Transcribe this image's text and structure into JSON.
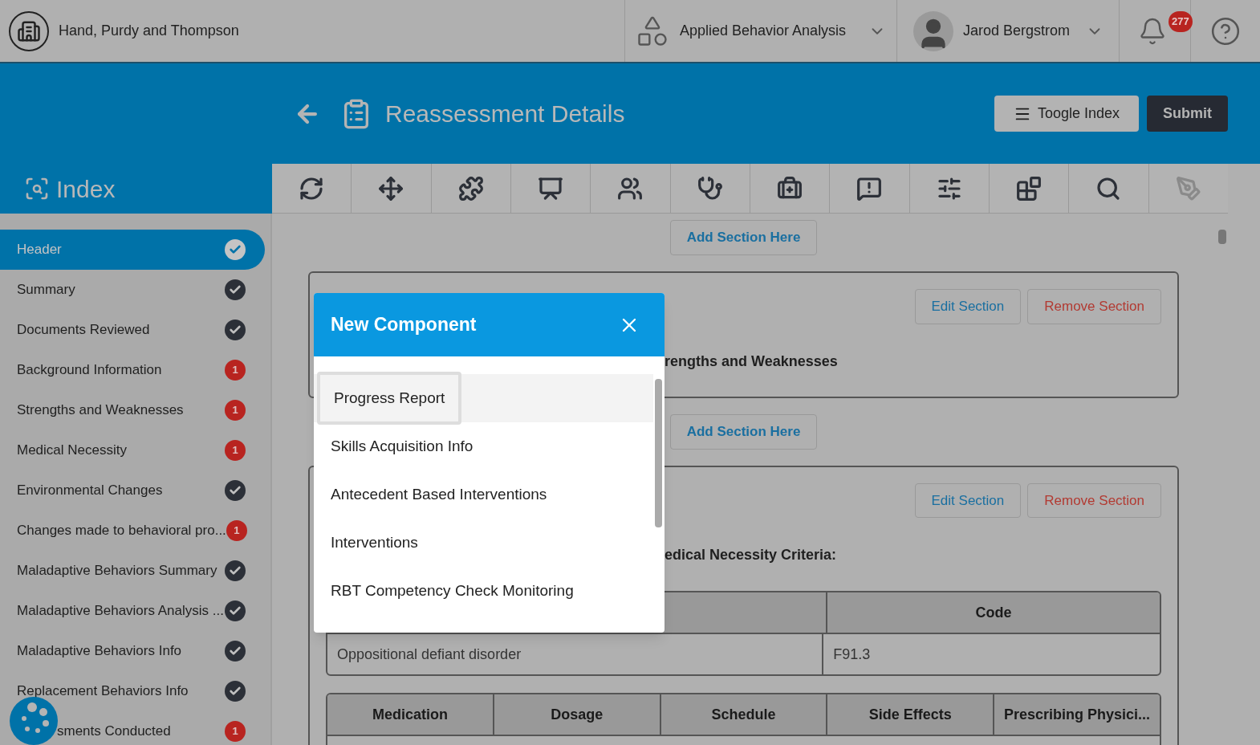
{
  "top_bar": {
    "company": "Hand, Purdy and Thompson",
    "program": "Applied Behavior Analysis",
    "user": "Jarod Bergstrom",
    "notifications": "277"
  },
  "page_header": {
    "title": "Reassessment Details",
    "toggle_button": "Toogle Index",
    "submit_button": "Submit"
  },
  "index": {
    "title": "Index",
    "items": [
      {
        "label": "Header",
        "selected": true,
        "complete": true
      },
      {
        "label": "Summary",
        "selected": false,
        "complete": true
      },
      {
        "label": "Documents Reviewed",
        "selected": false,
        "complete": true
      },
      {
        "label": "Background Information",
        "selected": false,
        "complete": false,
        "count": "1"
      },
      {
        "label": "Strengths and Weaknesses",
        "selected": false,
        "complete": false,
        "count": "1"
      },
      {
        "label": "Medical Necessity",
        "selected": false,
        "complete": false,
        "count": "1"
      },
      {
        "label": "Environmental Changes",
        "selected": false,
        "complete": true
      },
      {
        "label": "Changes made to behavioral pro...",
        "selected": false,
        "complete": false,
        "count": "1"
      },
      {
        "label": "Maladaptive Behaviors Summary",
        "selected": false,
        "complete": true
      },
      {
        "label": "Maladaptive Behaviors Analysis ...",
        "selected": false,
        "complete": true
      },
      {
        "label": "Maladaptive Behaviors Info",
        "selected": false,
        "complete": true
      },
      {
        "label": "Replacement Behaviors Info",
        "selected": false,
        "complete": true
      },
      {
        "label": "sments Conducted",
        "selected": false,
        "complete": false,
        "count": "1"
      }
    ]
  },
  "toolbar": [
    {
      "kind": "cycle",
      "disabled": false
    },
    {
      "kind": "move",
      "disabled": false
    },
    {
      "kind": "puzzle",
      "disabled": false
    },
    {
      "kind": "monitor",
      "disabled": false
    },
    {
      "kind": "users",
      "disabled": false
    },
    {
      "kind": "stethoscope",
      "disabled": false
    },
    {
      "kind": "medkit",
      "disabled": false
    },
    {
      "kind": "alert",
      "disabled": false
    },
    {
      "kind": "sliders",
      "disabled": false
    },
    {
      "kind": "blocks",
      "disabled": false
    },
    {
      "kind": "inspect",
      "disabled": false
    },
    {
      "kind": "pen",
      "disabled": true
    }
  ],
  "content": [
    {
      "kind": "add",
      "label": "Add Section Here"
    },
    {
      "kind": "section",
      "title": "rengths and Weaknesses",
      "edit": "Edit Section",
      "remove": "Remove Section"
    },
    {
      "kind": "add",
      "label": "Add Section Here"
    },
    {
      "kind": "section",
      "title": "edical Necessity Criteria:",
      "edit": "Edit Section",
      "remove": "Remove Section",
      "tables": [
        {
          "columns": [
            "",
            "Code"
          ],
          "rows": [
            [
              "Oppositional defiant disorder",
              "F91.3"
            ]
          ]
        },
        {
          "columns": [
            "Medication",
            "Dosage",
            "Schedule",
            "Side Effects",
            "Prescribing Physici..."
          ]
        }
      ]
    }
  ],
  "modal": {
    "title": "New Component",
    "items": [
      {
        "label": "Progress Report",
        "selected": true
      },
      {
        "label": "Skills Acquisition Info",
        "selected": false
      },
      {
        "label": "Antecedent Based Interventions",
        "selected": false
      },
      {
        "label": "Interventions",
        "selected": false
      },
      {
        "label": "RBT Competency Check Monitoring",
        "selected": false
      }
    ]
  }
}
